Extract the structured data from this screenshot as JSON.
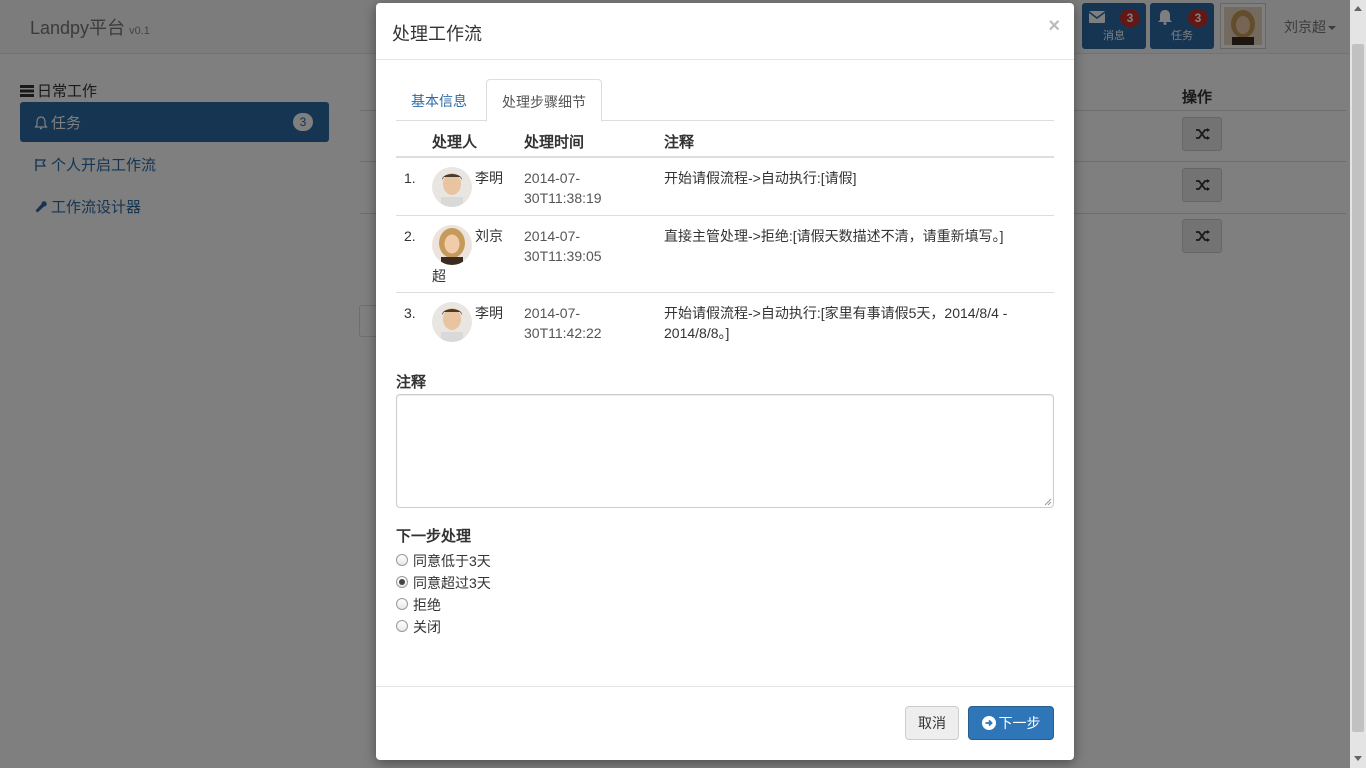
{
  "navbar": {
    "brand": "Landpy平台",
    "version": "v0.1",
    "messages": {
      "label": "消息",
      "count": "3",
      "icon": "envelope-icon"
    },
    "tasks": {
      "label": "任务",
      "count": "3",
      "icon": "bell-icon"
    },
    "user_name": "刘京超"
  },
  "sidebar": {
    "section_title": "日常工作",
    "items": [
      {
        "label": "任务",
        "badge": "3",
        "icon": "bell-icon",
        "active": true
      },
      {
        "label": "个人开启工作流",
        "icon": "flag-icon"
      },
      {
        "label": "工作流设计器",
        "icon": "wrench-icon"
      }
    ]
  },
  "background_table": {
    "op_header": "操作"
  },
  "modal": {
    "title": "处理工作流",
    "close": "×",
    "tabs": [
      {
        "label": "基本信息",
        "active": false
      },
      {
        "label": "处理步骤细节",
        "active": true
      }
    ],
    "steps_table": {
      "headers": {
        "person": "处理人",
        "time": "处理时间",
        "note": "注释"
      },
      "rows": [
        {
          "num": "1.",
          "person": "李明",
          "avatar": "male",
          "time": "2014-07-30T11:38:19",
          "time_line1": "2014-07-",
          "time_line2": "30T11:38:19",
          "note": "开始请假流程->自动执行:[请假]"
        },
        {
          "num": "2.",
          "person": "刘京超",
          "person_line1": "刘京",
          "person_line2": "超",
          "avatar": "female",
          "time": "2014-07-30T11:39:05",
          "time_line1": "2014-07-",
          "time_line2": "30T11:39:05",
          "note": "直接主管处理->拒绝:[请假天数描述不清，请重新填写。]"
        },
        {
          "num": "3.",
          "person": "李明",
          "avatar": "male",
          "time": "2014-07-30T11:42:22",
          "time_line1": "2014-07-",
          "time_line2": "30T11:42:22",
          "note": "开始请假流程->自动执行:[家里有事请假5天，2014/8/4 - 2014/8/8。]"
        }
      ]
    },
    "note_label": "注释",
    "note_value": "",
    "next_step_label": "下一步处理",
    "next_options": [
      {
        "label": "同意低于3天",
        "checked": false
      },
      {
        "label": "同意超过3天",
        "checked": true
      },
      {
        "label": "拒绝",
        "checked": false
      },
      {
        "label": "关闭",
        "checked": false
      }
    ],
    "cancel_label": "取消",
    "next_label": "下一步"
  },
  "colors": {
    "primary": "#2c6aa5",
    "badge_red": "#c9302c",
    "backdrop": "rgba(0,0,0,0.5)"
  }
}
